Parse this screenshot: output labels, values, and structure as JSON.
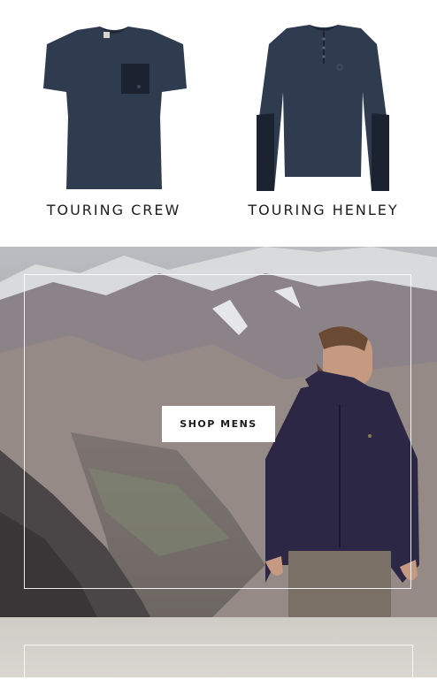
{
  "products": [
    {
      "name": "TOURING CREW",
      "image_icon": "tshirt-crew-icon"
    },
    {
      "name": "TOURING HENLEY",
      "image_icon": "henley-longsleeve-icon"
    }
  ],
  "hero": {
    "button_label": "SHOP MENS",
    "image_subject": "man in navy jacket in mountains"
  },
  "colors": {
    "garment": "#2c3a4e",
    "garment_dark": "#1a2230",
    "jacket": "#2c2745"
  }
}
